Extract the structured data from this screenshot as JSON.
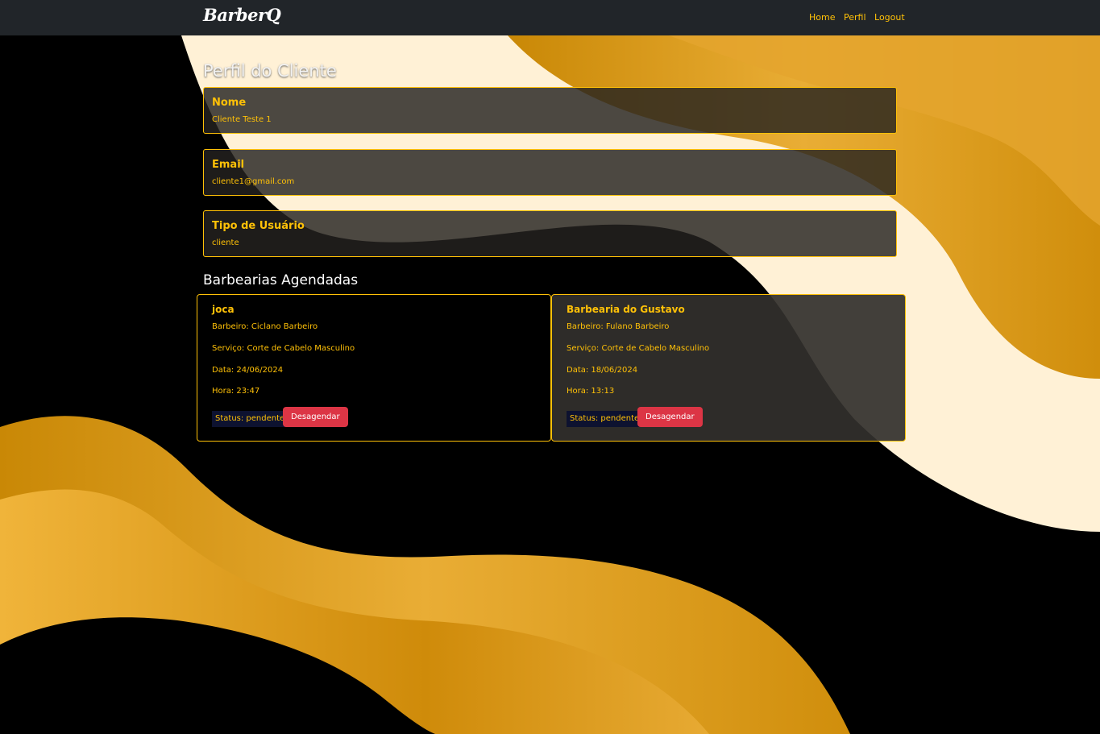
{
  "nav": {
    "brand": "BarberQ",
    "links": [
      "Home",
      "Perfil",
      "Logout"
    ]
  },
  "profile": {
    "title": "Perfil do Cliente",
    "fields": [
      {
        "label": "Nome",
        "value": "Cliente Teste 1"
      },
      {
        "label": "Email",
        "value": "cliente1@gmail.com"
      },
      {
        "label": "Tipo de Usuário",
        "value": "cliente"
      }
    ]
  },
  "appointments": {
    "title": "Barbearias Agendadas",
    "items": [
      {
        "shop": "joca",
        "barber": "Barbeiro: Ciclano Barbeiro",
        "service": "Serviço: Corte de Cabelo Masculino",
        "date": "Data: 24/06/2024",
        "time": "Hora: 23:47",
        "status": "Status: pendente",
        "action": "Desagendar"
      },
      {
        "shop": "Barbearia do Gustavo",
        "barber": "Barbeiro: Fulano Barbeiro",
        "service": "Serviço: Corte de Cabelo Masculino",
        "date": "Data: 18/06/2024",
        "time": "Hora: 13:13",
        "status": "Status: pendente",
        "action": "Desagendar"
      }
    ]
  },
  "colors": {
    "accent": "#ffc107",
    "navbar": "#212529",
    "danger": "#dc3545",
    "cream": "#fff1d6",
    "gold": "#e0a020"
  }
}
